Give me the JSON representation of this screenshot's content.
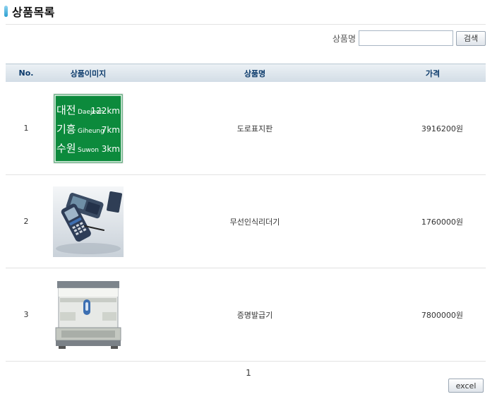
{
  "page": {
    "title": "상품목록"
  },
  "search": {
    "label": "상품명",
    "value": "",
    "placeholder": "",
    "button_label": "검색"
  },
  "table": {
    "headers": {
      "no": "No.",
      "image": "상품이미지",
      "name": "상품명",
      "price": "가격"
    },
    "rows": [
      {
        "no": "1",
        "name": "도로표지판",
        "price": "3916200원",
        "image_icon": "road-sign-image"
      },
      {
        "no": "2",
        "name": "무선인식리더기",
        "price": "1760000원",
        "image_icon": "wireless-rfid-reader-image"
      },
      {
        "no": "3",
        "name": "증명발급기",
        "price": "7800000원",
        "image_icon": "certificate-issuing-kiosk-image"
      }
    ]
  },
  "sign": {
    "rows": [
      {
        "korean": "대전",
        "roman": "Daejeon",
        "distance": "122km"
      },
      {
        "korean": "기흥",
        "roman": "Giheung",
        "distance": "7km"
      },
      {
        "korean": "수원",
        "roman": "Suwon",
        "distance": "3km"
      }
    ]
  },
  "pagination": {
    "current": "1"
  },
  "footer": {
    "excel_label": "excel"
  },
  "colors": {
    "header_text": "#0b3a6b",
    "sign_green": "#0c8a3c",
    "title_marker": "#2a9fd0"
  }
}
